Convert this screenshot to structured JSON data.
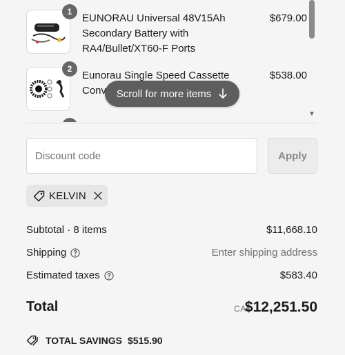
{
  "cart": {
    "items": [
      {
        "qty": "1",
        "name": "EUNORAU Universal 48V15Ah Secondary Battery with RA4/Bullet/XT60-F Ports",
        "price": "$679.00",
        "thumb_icon": "battery-kit-icon"
      },
      {
        "qty": "2",
        "name": "Eunorau Single Speed Cassette Conv",
        "price": "$538.00",
        "thumb_icon": "cassette-kit-icon"
      }
    ],
    "scroll_hint": "Scroll for more items",
    "scroll_hint_icon": "arrow-down-icon"
  },
  "discount": {
    "placeholder": "Discount code",
    "value": "",
    "apply_label": "Apply"
  },
  "applied_code": {
    "label": "KELVIN",
    "icon": "tag-icon",
    "remove_icon": "close-icon"
  },
  "summary": {
    "subtotal_label": "Subtotal · 8 items",
    "subtotal_value": "$11,668.10",
    "shipping_label": "Shipping",
    "shipping_value": "Enter shipping address",
    "taxes_label": "Estimated taxes",
    "taxes_value": "$583.40",
    "help_icon": "help-circle-icon"
  },
  "total": {
    "label": "Total",
    "currency": "CAD",
    "amount": "$12,251.50"
  },
  "savings": {
    "icon": "tags-icon",
    "label": "TOTAL SAVINGS",
    "amount": "$515.90"
  },
  "colors": {
    "background": "#f5f5f5",
    "badge": "#666666",
    "pill": "#5e5e5e",
    "muted_text": "#707070",
    "tag_background": "#e6e6e6"
  }
}
